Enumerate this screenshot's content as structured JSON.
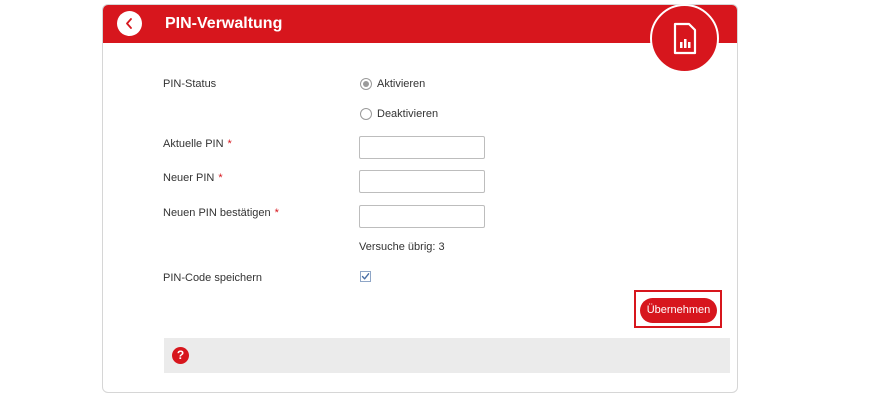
{
  "header": {
    "title": "PIN-Verwaltung",
    "back_icon": "chevron-left-icon",
    "badge_icon": "sim-card-icon"
  },
  "form": {
    "pin_status_label": "PIN-Status",
    "activate_label": "Aktivieren",
    "deactivate_label": "Deaktivieren",
    "pin_status_selected": "Aktivieren",
    "current_pin_label": "Aktuelle PIN",
    "new_pin_label": "Neuer PIN",
    "confirm_pin_label": "Neuen PIN bestätigen",
    "required_marker": "*",
    "attempts_text": "Versuche übrig: 3",
    "save_pin_label": "PIN-Code speichern",
    "save_pin_checked": true,
    "submit_label": "Übernehmen"
  },
  "help": {
    "icon_text": "?"
  },
  "colors": {
    "brand_red": "#d7161d",
    "help_bg": "#ebebeb",
    "border": "#d6d6d6"
  }
}
